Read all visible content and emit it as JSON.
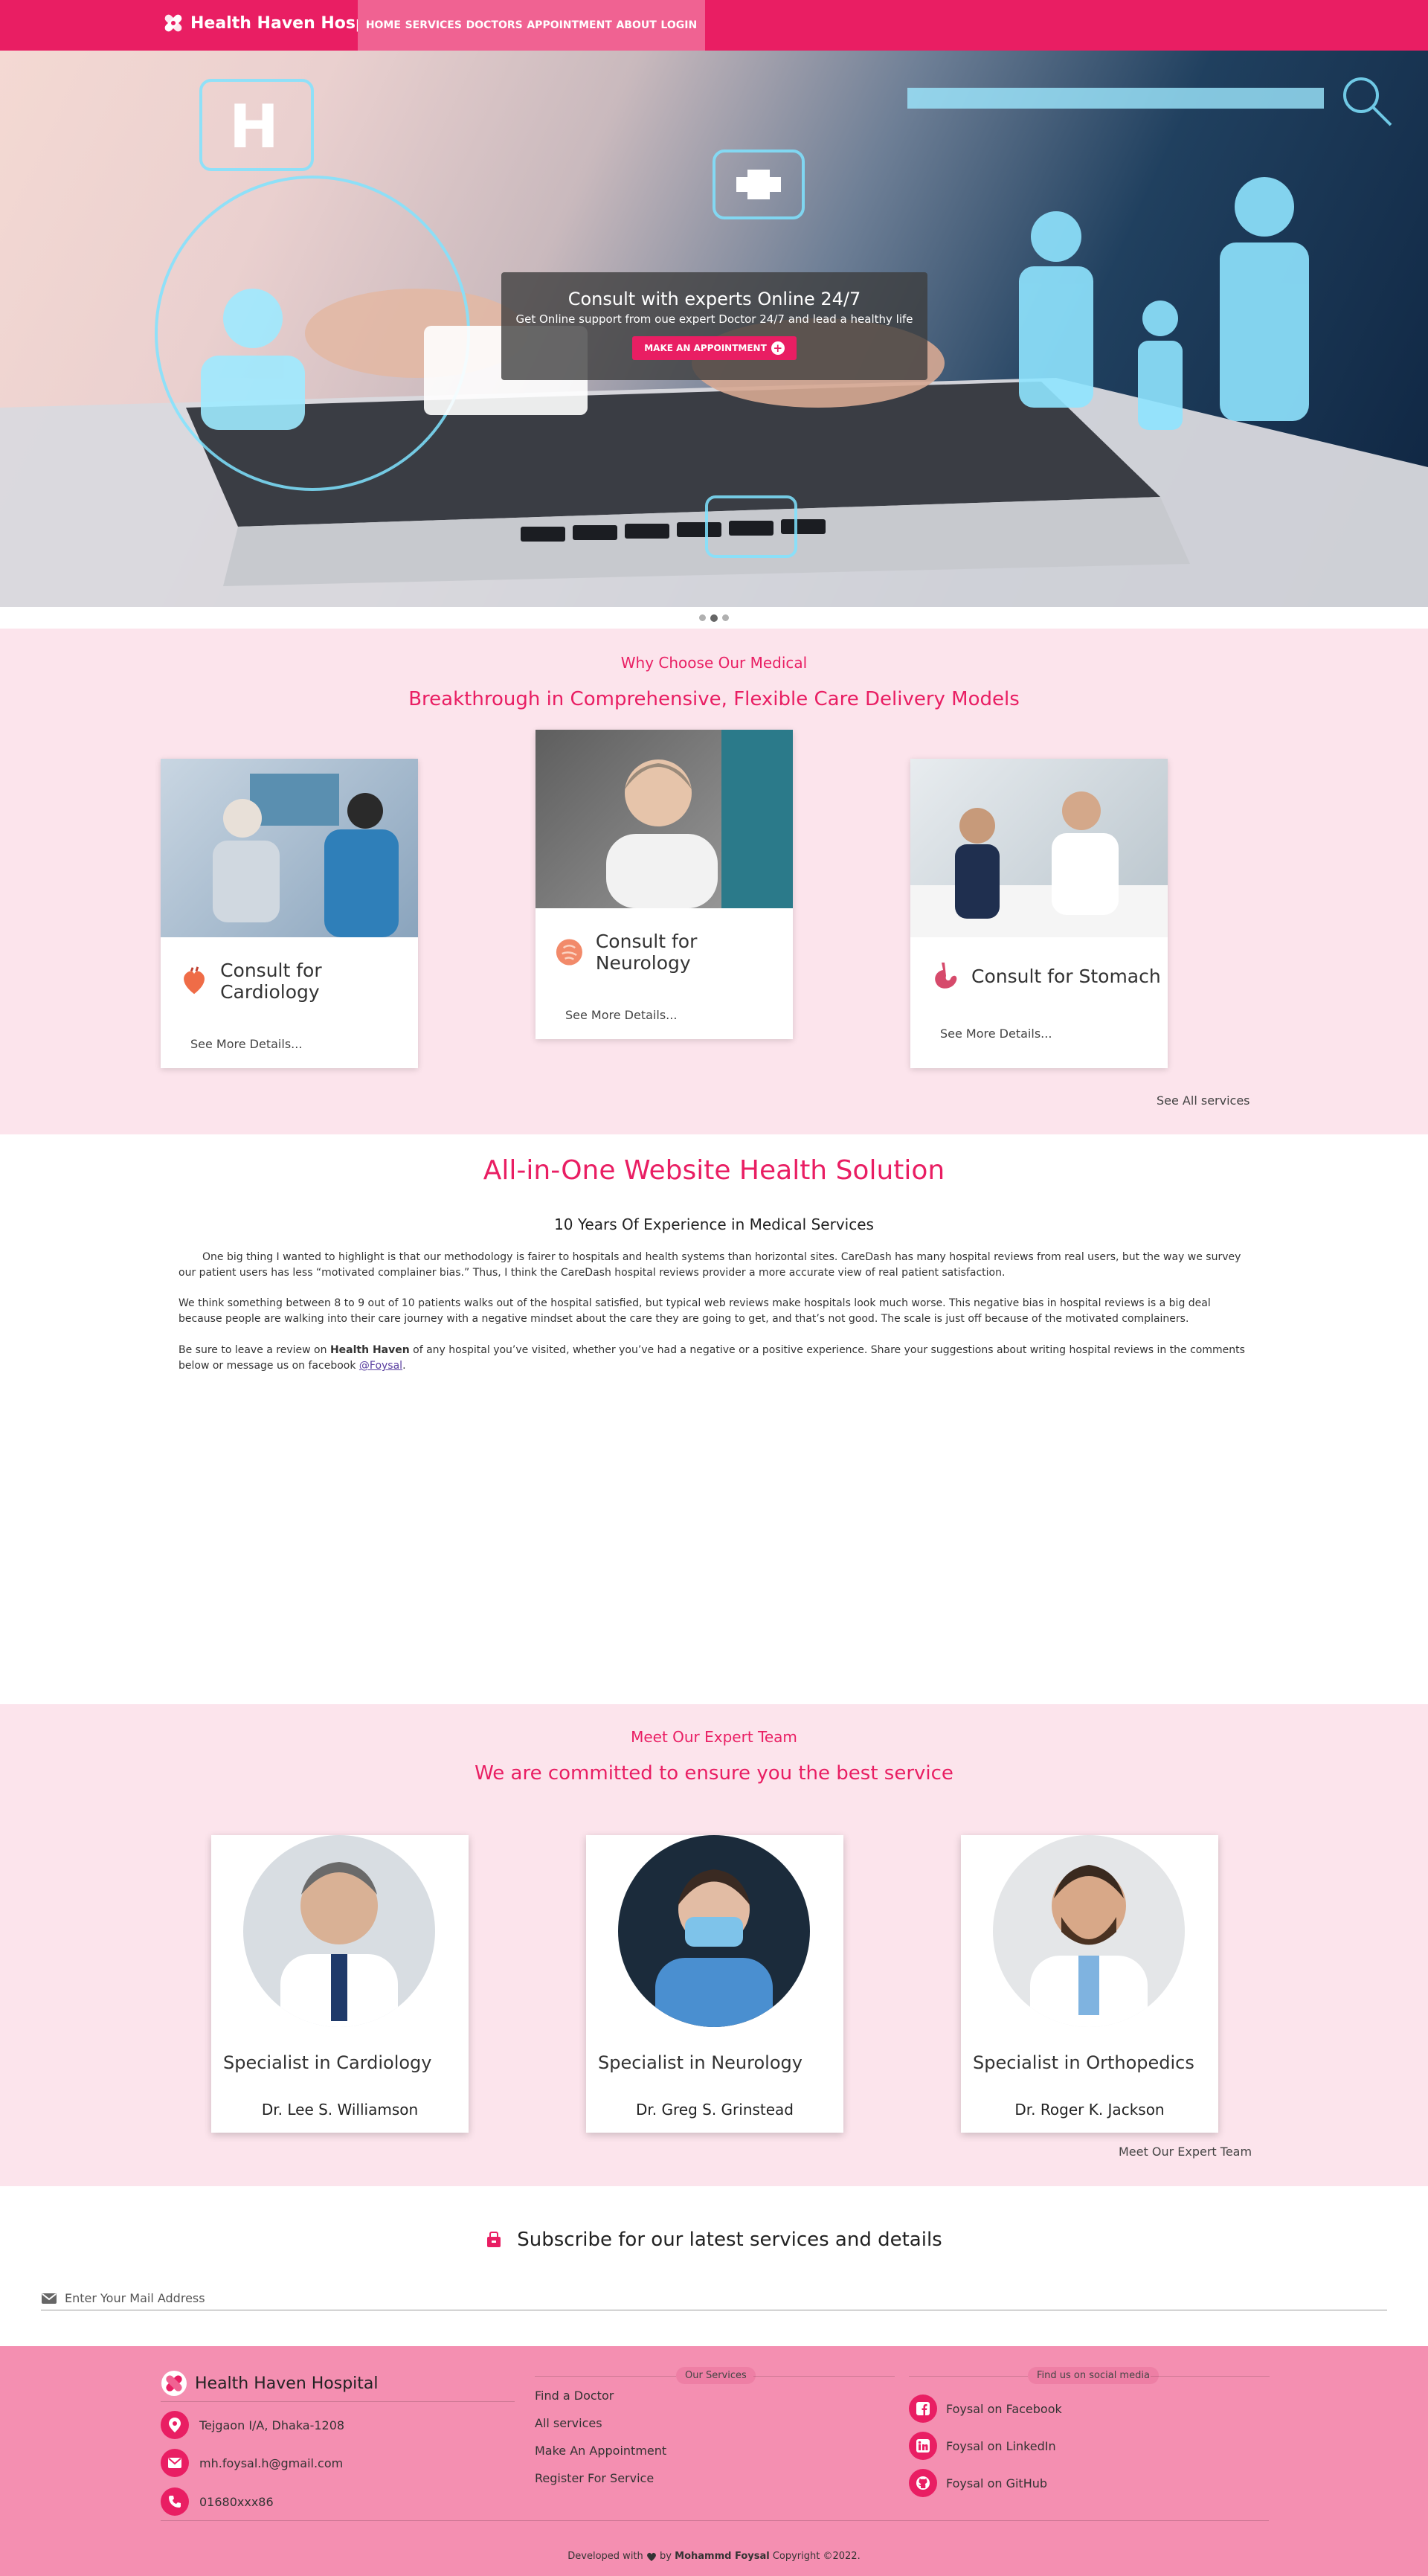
{
  "nav": {
    "brand": "Health Haven Hospital",
    "links": [
      "HOME",
      "SERVICES",
      "DOCTORS",
      "APPOINTMENT",
      "ABOUT",
      "LOGIN"
    ]
  },
  "hero": {
    "title": "Consult with experts Online 24/7",
    "subtitle": "Get Online support from oue expert Doctor 24/7 and lead a healthy life",
    "button": "MAKE AN APPOINTMENT",
    "slides": 3,
    "active_slide": 2
  },
  "services": {
    "kicker": "Why Choose Our Medical",
    "title": "Breakthrough in Comprehensive, Flexible Care Delivery Models",
    "cards": [
      {
        "name": "Consult for Cardiology",
        "more": "See More Details...",
        "icon": "heart-organ-icon"
      },
      {
        "name": "Consult for Neurology",
        "more": "See More Details...",
        "icon": "brain-icon"
      },
      {
        "name": "Consult for Stomach",
        "more": "See More Details...",
        "icon": "stomach-icon"
      }
    ],
    "see_all": "See All services"
  },
  "about": {
    "title": "All-in-One Website Health Solution",
    "subtitle": "10 Years Of Experience in Medical Services",
    "p1": "One big thing I wanted to highlight is that our methodology is fairer to hospitals and health systems than horizontal sites. CareDash has many hospital reviews from real users, but the way we survey our patient users has less “motivated complainer bias.” Thus, I think the CareDash hospital reviews provider a more accurate view of real patient satisfaction.",
    "p2": "We think something between 8 to 9 out of 10 patients walks out of the hospital satisfied, but typical web reviews make hospitals look much worse. This negative bias in hospital reviews is a big deal because people are walking into their care journey with a negative mindset about the care they are going to get, and that’s not good. The scale is just off because of the motivated complainers.",
    "p3_before": "Be sure to leave a review on ",
    "p3_bold": "Health Haven",
    "p3_after": " of any hospital you’ve visited, whether you’ve had a negative or a positive experience. Share your suggestions about writing hospital reviews in the comments below or message us on facebook ",
    "p3_link": "@Foysal",
    "p3_end": "."
  },
  "team": {
    "kicker": "Meet Our Expert Team",
    "title": "We are committed to ensure you the best service",
    "doctors": [
      {
        "specialty": "Specialist in Cardiology",
        "name": "Dr. Lee S. Williamson"
      },
      {
        "specialty": "Specialist in Neurology",
        "name": "Dr. Greg S. Grinstead"
      },
      {
        "specialty": "Specialist in Orthopedics",
        "name": "Dr. Roger K. Jackson"
      }
    ],
    "more": "Meet Our Expert Team"
  },
  "subscribe": {
    "title": "Subscribe for our latest services and details",
    "placeholder": "Enter Your Mail Address"
  },
  "footer": {
    "brand": "Health Haven Hospital",
    "address": "Tejgaon I/A, Dhaka-1208",
    "email": "mh.foysal.h@gmail.com",
    "phone": "01680xxx86",
    "services_pill": "Our Services",
    "services": [
      "Find a Doctor",
      "All services",
      "Make An Appointment",
      "Register For Service"
    ],
    "social_pill": "Find us on social media",
    "social": [
      "Foysal on Facebook",
      "Foysal on LinkedIn",
      "Foysal on GitHub"
    ],
    "credit_before": "Developed with",
    "credit_by": "by",
    "credit_name": "Mohammd Foysal",
    "credit_after": "Copyright ©2022."
  },
  "colors": {
    "primary": "#e91e63",
    "nav_highlight": "#f06292",
    "section_bg": "#fce4ec",
    "footer_bg": "#f48fb1"
  }
}
